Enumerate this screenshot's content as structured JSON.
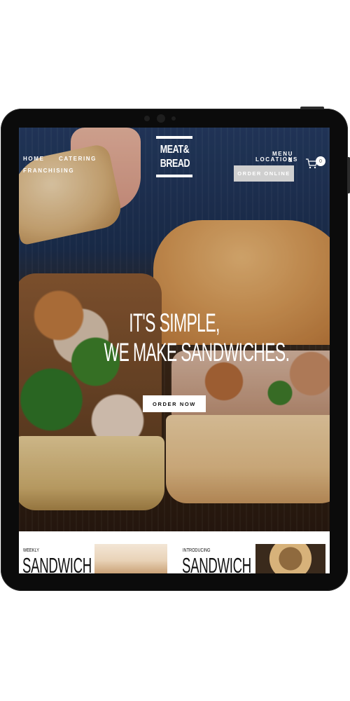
{
  "nav": {
    "home": "HOME",
    "catering": "CATERING",
    "franchising": "FRANCHISING",
    "menu_locations_line1": "MENU &",
    "menu_locations_line2": "LOCATIONS",
    "order_online": "ORDER ONLINE",
    "cart_count": "0"
  },
  "logo": {
    "line1": "MEAT&",
    "line2": "BREAD"
  },
  "hero": {
    "headline_line1": "IT'S SIMPLE,",
    "headline_line2": "WE MAKE SANDWICHES.",
    "cta": "ORDER NOW"
  },
  "cards": [
    {
      "label": "WEEKLY",
      "title": "SANDWICH"
    },
    {
      "label": "INTRODUCING",
      "title": "SANDWICH"
    }
  ],
  "colors": {
    "device": "#0b0b0b",
    "hero_blue": "#253b62",
    "button_gray": "#cfcfcf",
    "white": "#ffffff"
  }
}
